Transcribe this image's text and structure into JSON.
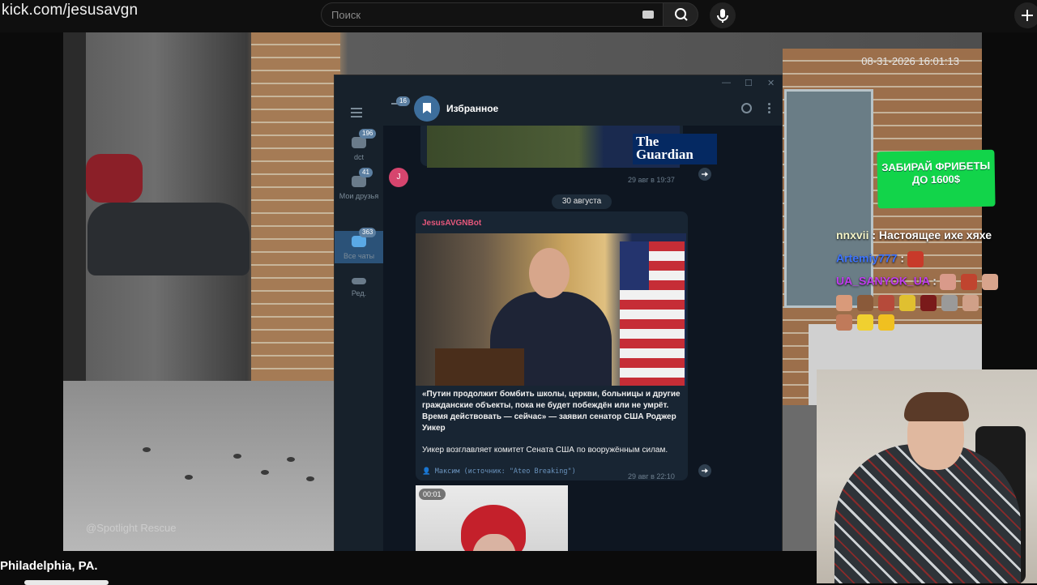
{
  "browser": {
    "url": "kick.com/jesusavgn",
    "search_placeholder": "Поиск"
  },
  "stream": {
    "timestamp": "08-31-2026 16:01:13",
    "watermark": "@Spotlight Rescue",
    "location_caption": "Philadelphia, PA."
  },
  "telegram": {
    "chat_title": "Избранное",
    "unread_badge": "16",
    "sidebar": [
      {
        "label": "dct",
        "badge": "196"
      },
      {
        "label": "Мои друзья",
        "badge": "41"
      },
      {
        "label": "Все чаты",
        "badge": "363"
      },
      {
        "label": "Ред.",
        "badge": ""
      }
    ],
    "messages": [
      {
        "image_logo": "The Guardian",
        "time": "29 авг в 19:37",
        "avatar_letter": "J"
      },
      {
        "date_divider": "30 августа"
      },
      {
        "sender": "JesusAVGNBot",
        "text_bold": "«Путин продолжит бомбить школы, церкви, больницы и другие гражданские объекты, пока не будет побеждён или не умрёт. Время действовать — сейчас» — заявил сенатор США Роджер Уикер",
        "text": "Уикер возглавляет комитет Сената США по вооружённым силам.",
        "signature": "Максим (источник: \"Ateo Breaking\")",
        "time": "29 авг в 22:10"
      },
      {
        "video_duration": "00:01"
      }
    ]
  },
  "promo": {
    "text": "ЗАБИРАЙ ФРИБЕТЫ ДО 1600$",
    "color": "#12d44a"
  },
  "kick_chat": [
    {
      "user": "nnxvii",
      "message": "Настоящее ихе хяхе",
      "color": "#f5f5c8"
    },
    {
      "user": "Artemiy777",
      "message": "",
      "color": "#3d74ff"
    },
    {
      "user": "UA_SANYOK_UA",
      "message": "",
      "color": "#c13bf0"
    }
  ]
}
